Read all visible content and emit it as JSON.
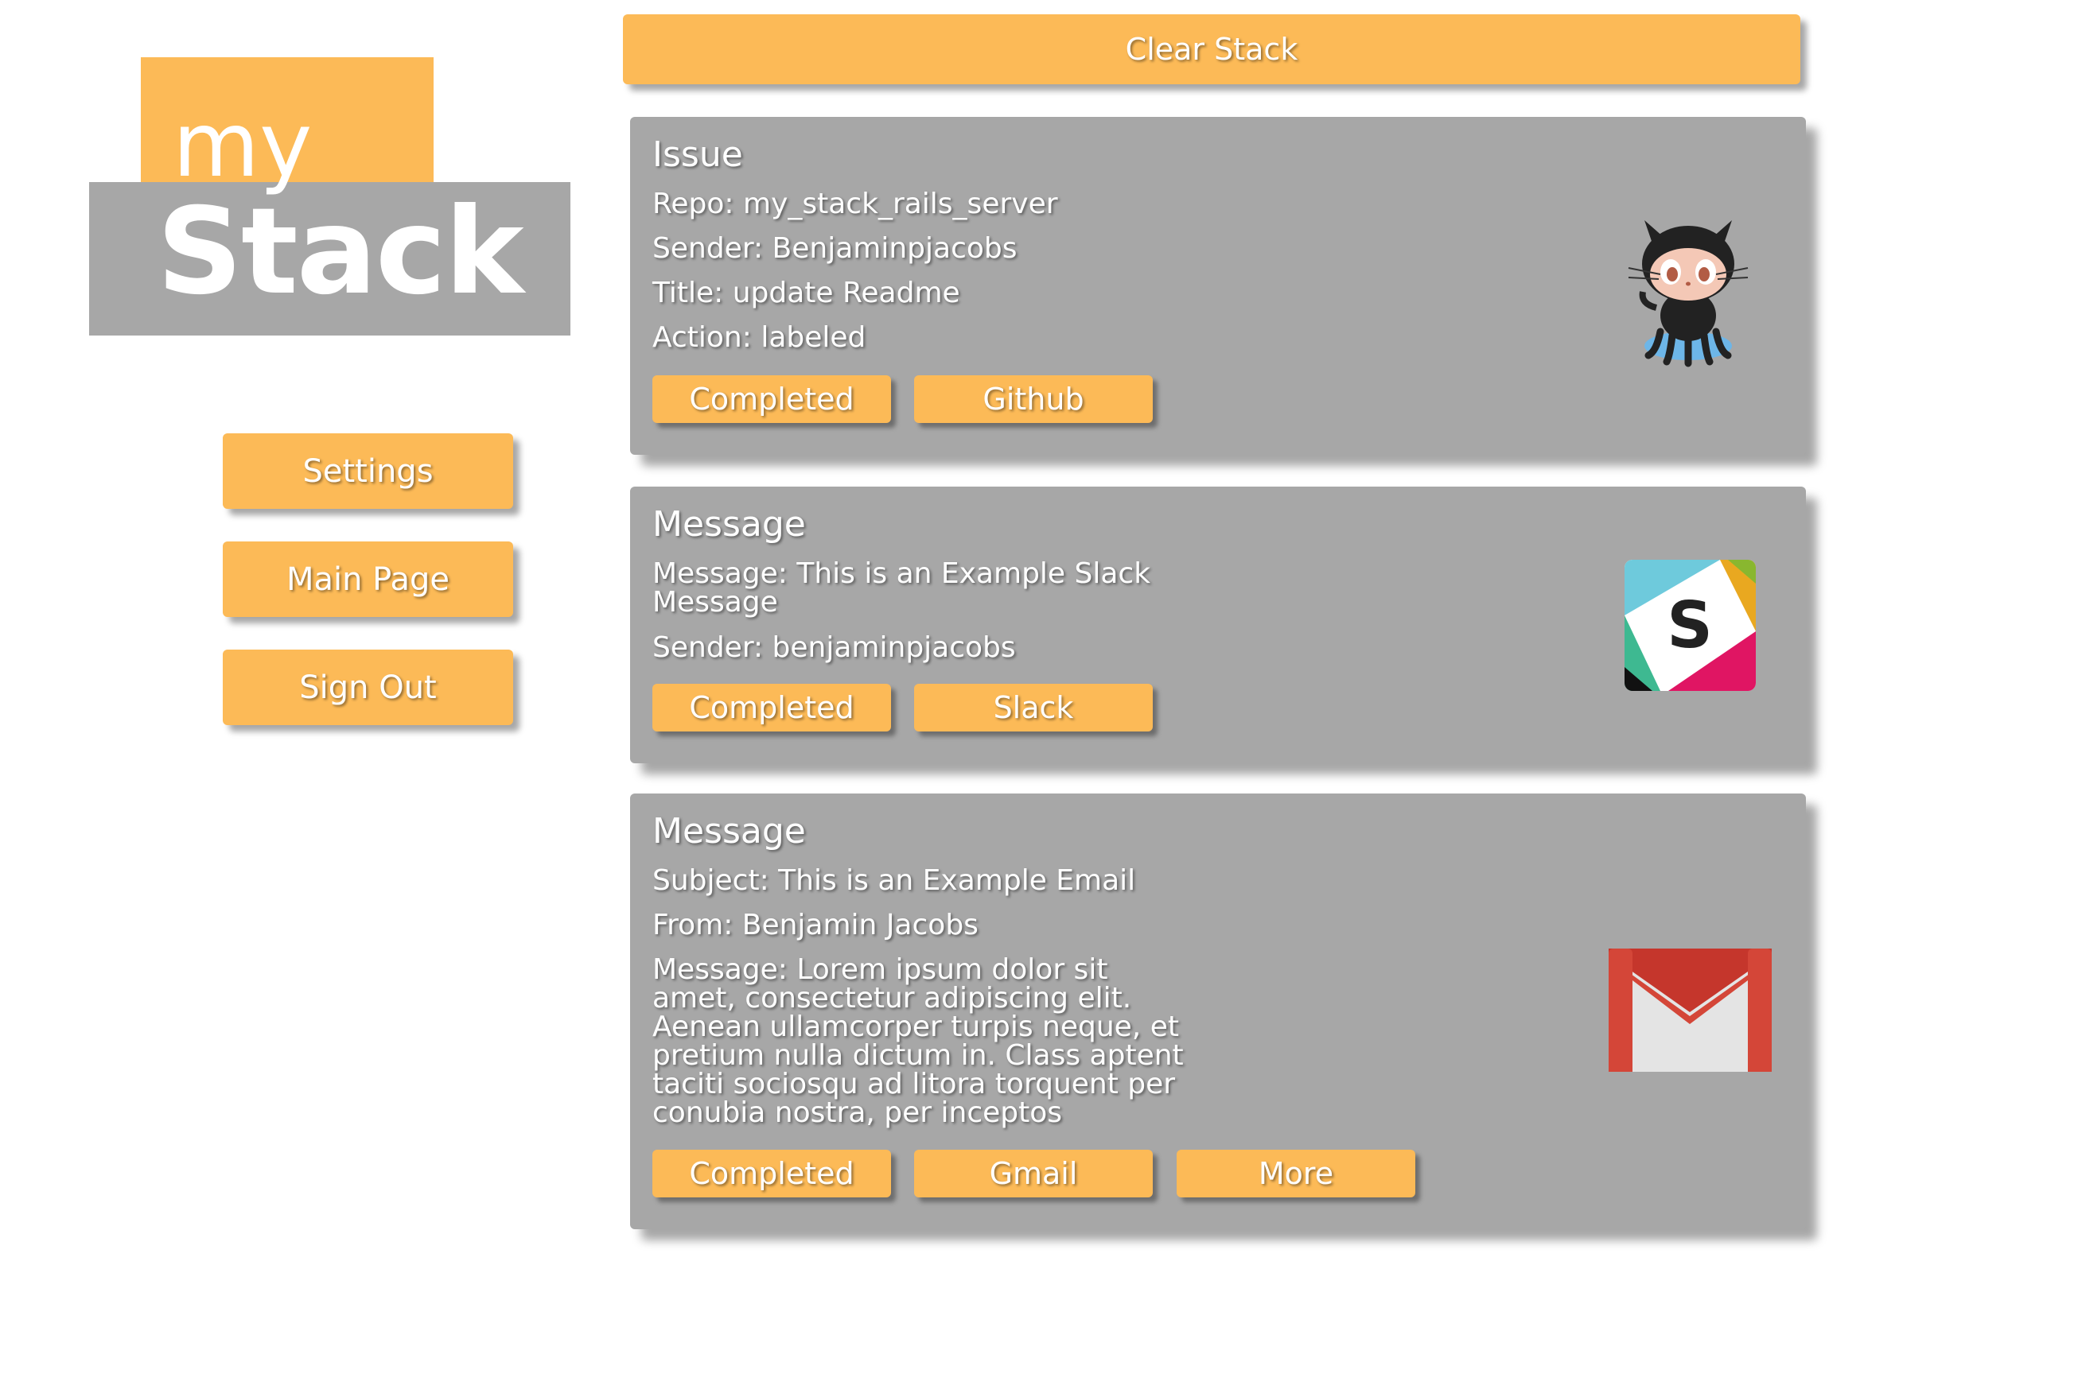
{
  "logo": {
    "top_text": "my",
    "bottom_text": "Stack"
  },
  "nav": {
    "settings": "Settings",
    "main_page": "Main Page",
    "sign_out": "Sign Out"
  },
  "clear_stack": "Clear Stack",
  "cards": [
    {
      "title": "Issue",
      "lines": [
        "Repo: my_stack_rails_server",
        "Sender: Benjaminpjacobs",
        "Title: update Readme",
        "Action: labeled"
      ],
      "buttons": [
        "Completed",
        "Github"
      ],
      "icon": "github-octocat-icon"
    },
    {
      "title": "Message",
      "lines": [
        "Message: This is an Example Slack Message",
        "Sender: benjaminpjacobs"
      ],
      "buttons": [
        "Completed",
        "Slack"
      ],
      "icon": "slack-icon"
    },
    {
      "title": "Message",
      "lines": [
        "Subject: This is an Example Email",
        "From: Benjamin Jacobs",
        "Message: Lorem ipsum dolor sit amet, consectetur adipiscing elit. Aenean ullamcorper turpis neque, et pretium nulla dictum in. Class aptent taciti sociosqu ad litora torquent per conubia nostra, per inceptos"
      ],
      "buttons": [
        "Completed",
        "Gmail",
        "More"
      ],
      "icon": "gmail-icon"
    }
  ],
  "colors": {
    "accent": "#fcba57",
    "card": "#a7a7a7",
    "text": "#ffffff"
  }
}
